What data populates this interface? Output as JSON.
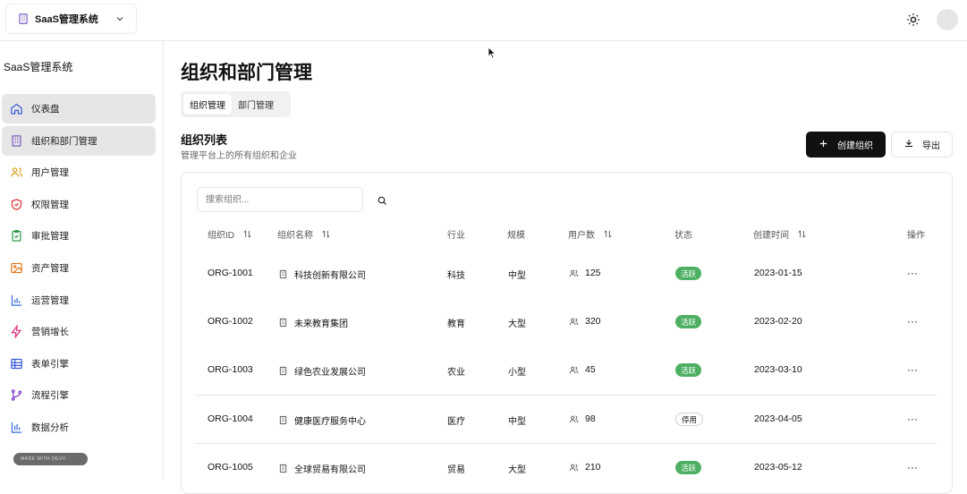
{
  "app": {
    "switcher_label": "SaaS管理系统"
  },
  "sidebar": {
    "title": "SaaS管理系统",
    "items": [
      {
        "label": "仪表盘",
        "icon": "home-icon",
        "active": true
      },
      {
        "label": "组织和部门管理",
        "icon": "building-icon",
        "active": true
      },
      {
        "label": "用户管理",
        "icon": "users-icon",
        "active": false
      },
      {
        "label": "权限管理",
        "icon": "shield-icon",
        "active": false
      },
      {
        "label": "审批管理",
        "icon": "clipboard-check-icon",
        "active": false
      },
      {
        "label": "资产管理",
        "icon": "image-icon",
        "active": false
      },
      {
        "label": "运营管理",
        "icon": "bar-chart-icon",
        "active": false
      },
      {
        "label": "营销增长",
        "icon": "lightning-icon",
        "active": false
      },
      {
        "label": "表单引擎",
        "icon": "table-icon",
        "active": false
      },
      {
        "label": "流程引擎",
        "icon": "git-branch-icon",
        "active": false
      },
      {
        "label": "数据分析",
        "icon": "chart-icon",
        "active": false
      }
    ],
    "badge": "MADE WITH DEVV"
  },
  "main": {
    "title": "组织和部门管理",
    "tabs": [
      "组织管理",
      "部门管理"
    ],
    "section_title": "组织列表",
    "section_desc": "管理平台上的所有组织和企业",
    "create_label": "创建组织",
    "export_label": "导出",
    "search_placeholder": "搜索组织...",
    "columns": [
      "组织ID",
      "组织名称",
      "行业",
      "规模",
      "用户数",
      "状态",
      "创建时间",
      "操作"
    ],
    "rows": [
      {
        "id": "ORG-1001",
        "name": "科技创新有限公司",
        "industry": "科技",
        "size": "中型",
        "users": "125",
        "status": "活跃",
        "status_type": "active",
        "created": "2023-01-15"
      },
      {
        "id": "ORG-1002",
        "name": "未来教育集团",
        "industry": "教育",
        "size": "大型",
        "users": "320",
        "status": "活跃",
        "status_type": "active",
        "created": "2023-02-20"
      },
      {
        "id": "ORG-1003",
        "name": "绿色农业发展公司",
        "industry": "农业",
        "size": "小型",
        "users": "45",
        "status": "活跃",
        "status_type": "active",
        "created": "2023-03-10"
      },
      {
        "id": "ORG-1004",
        "name": "健康医疗服务中心",
        "industry": "医疗",
        "size": "中型",
        "users": "98",
        "status": "停用",
        "status_type": "inactive",
        "created": "2023-04-05"
      },
      {
        "id": "ORG-1005",
        "name": "全球贸易有限公司",
        "industry": "贸易",
        "size": "大型",
        "users": "210",
        "status": "活跃",
        "status_type": "active",
        "created": "2023-05-12"
      }
    ],
    "more_label": "···"
  },
  "colors": {
    "active_badge": "#4caf61",
    "primary_button": "#111111",
    "active_nav": "#e6e6e6"
  }
}
